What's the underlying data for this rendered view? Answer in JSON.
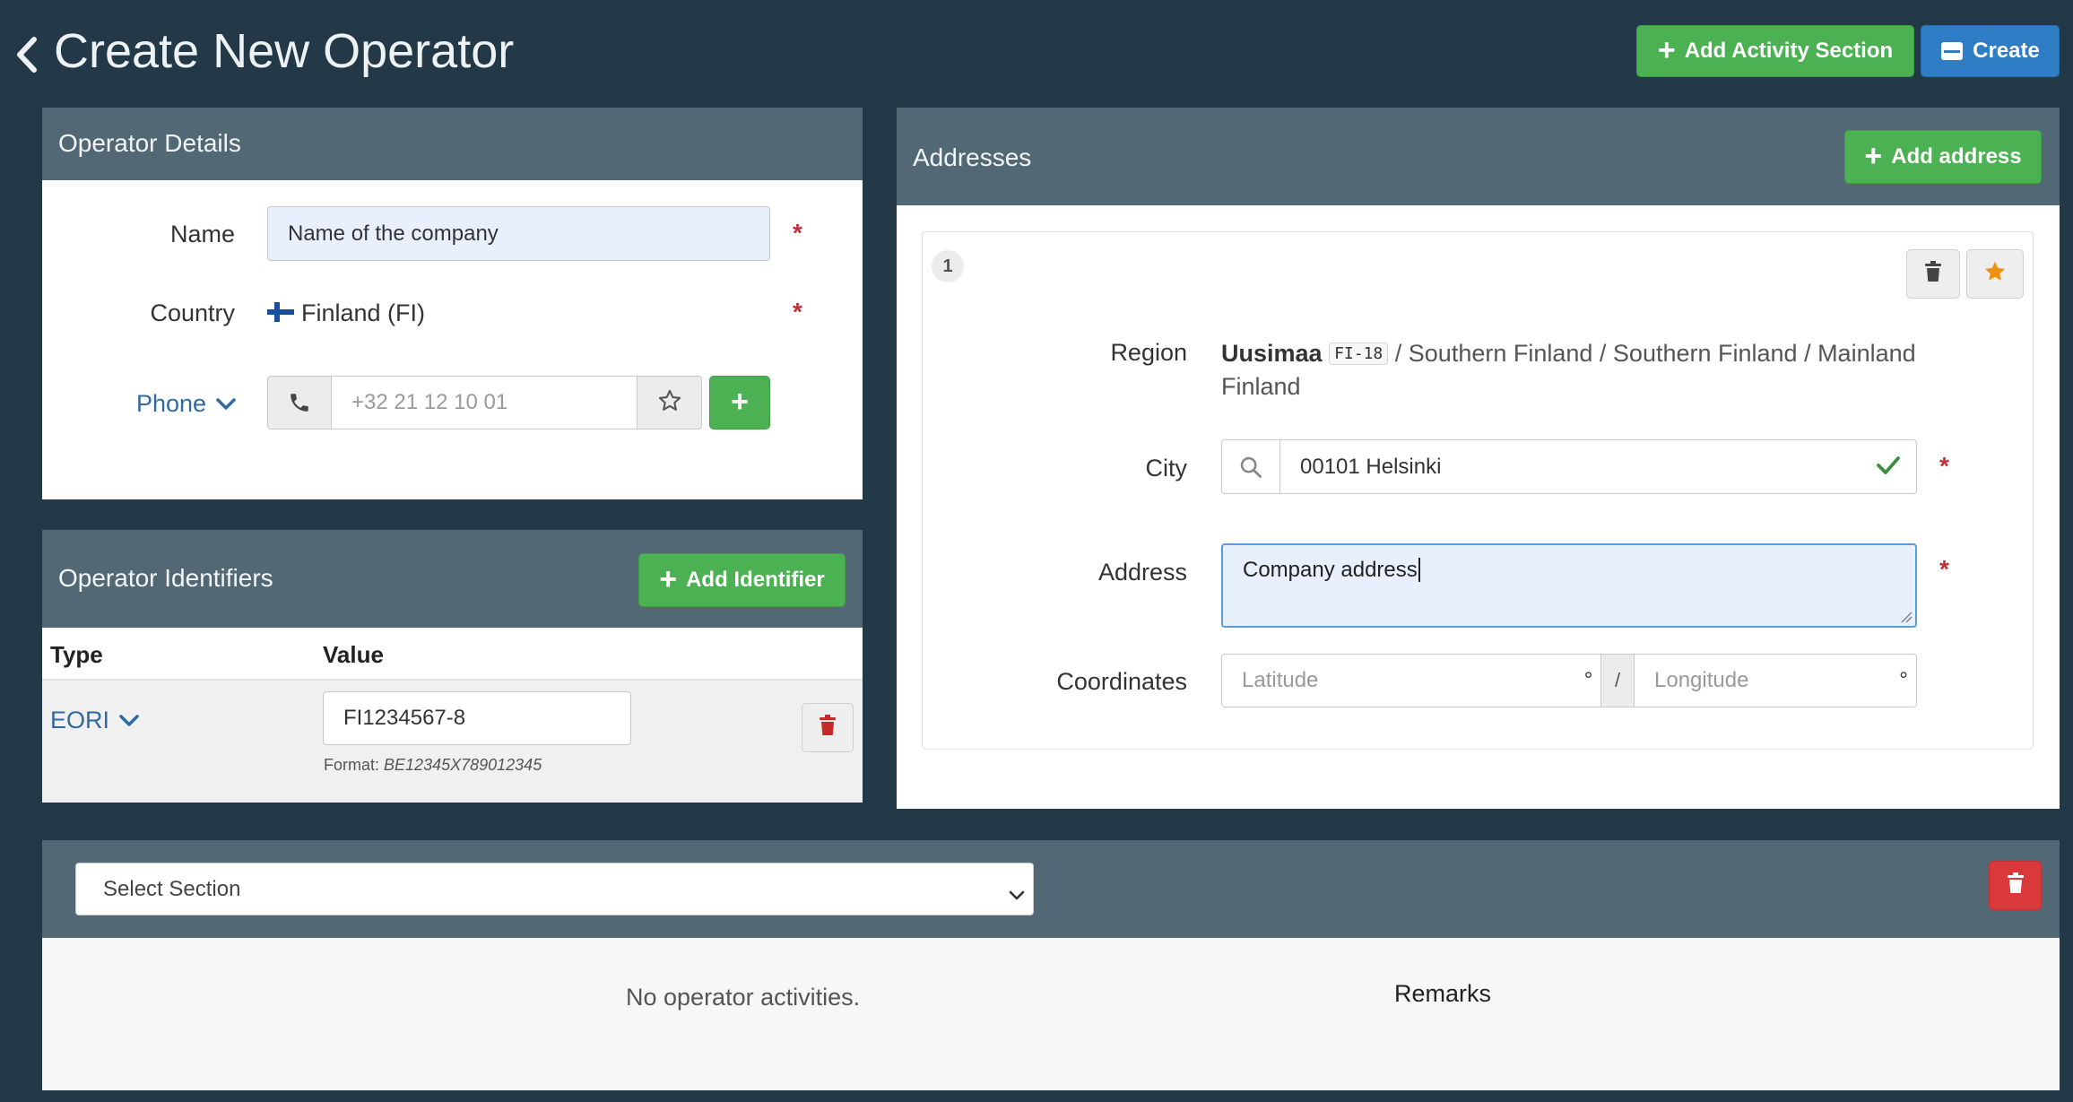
{
  "header": {
    "title": "Create New Operator",
    "add_activity_label": "Add Activity Section",
    "create_label": "Create"
  },
  "operator_details": {
    "heading": "Operator Details",
    "name_label": "Name",
    "name_value": "Name of the company",
    "country_label": "Country",
    "country_value": "Finland (FI)",
    "phone_label": "Phone",
    "phone_placeholder": "+32 21 12 10 01",
    "required_mark": "*"
  },
  "identifiers": {
    "heading": "Operator Identifiers",
    "add_label": "Add Identifier",
    "col_type": "Type",
    "col_value": "Value",
    "rows": [
      {
        "type": "EORI",
        "value": "FI1234567-8",
        "format_prefix": "Format:",
        "format_example": "BE12345X789012345"
      }
    ]
  },
  "addresses": {
    "heading": "Addresses",
    "add_label": "Add address",
    "items": [
      {
        "index": "1",
        "region_label": "Region",
        "region_name": "Uusimaa",
        "region_code": "FI-18",
        "region_path": "/ Southern Finland / Southern Finland / Mainland",
        "region_path_cont": "Finland",
        "city_label": "City",
        "city_value": "00101 Helsinki",
        "address_label": "Address",
        "address_value": "Company address",
        "coordinates_label": "Coordinates",
        "latitude_placeholder": "Latitude",
        "longitude_placeholder": "Longitude",
        "degree_symbol": "°",
        "separator": "/"
      }
    ]
  },
  "activities": {
    "select_placeholder": "Select Section",
    "empty_text": "No operator activities.",
    "remarks_label": "Remarks"
  },
  "colors": {
    "background": "#243947",
    "panel_header": "#526875",
    "success": "#4cb153",
    "primary": "#2f7dc4",
    "danger": "#d9393a",
    "link": "#2f6aa3",
    "required": "#c0303a",
    "star": "#f0900f"
  },
  "icons": [
    "chevron-left-icon",
    "plus-icon",
    "save-icon",
    "phone-icon",
    "star-icon",
    "trash-icon",
    "search-icon",
    "check-icon",
    "chevron-down-icon",
    "finland-flag-icon"
  ]
}
